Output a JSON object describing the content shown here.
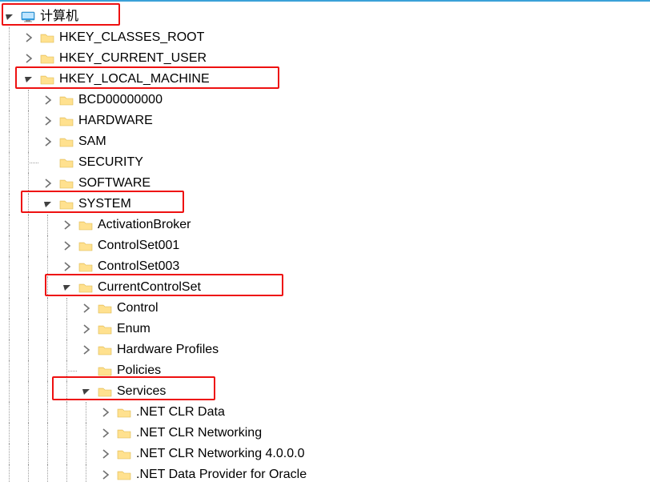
{
  "root": {
    "label": "计算机"
  },
  "hkcr": {
    "label": "HKEY_CLASSES_ROOT"
  },
  "hkcu": {
    "label": "HKEY_CURRENT_USER"
  },
  "hklm": {
    "label": "HKEY_LOCAL_MACHINE"
  },
  "bcd": {
    "label": "BCD00000000"
  },
  "hardware": {
    "label": "HARDWARE"
  },
  "sam": {
    "label": "SAM"
  },
  "security": {
    "label": "SECURITY"
  },
  "software": {
    "label": "SOFTWARE"
  },
  "system": {
    "label": "SYSTEM"
  },
  "activationbroker": {
    "label": "ActivationBroker"
  },
  "cs001": {
    "label": "ControlSet001"
  },
  "cs003": {
    "label": "ControlSet003"
  },
  "ccs": {
    "label": "CurrentControlSet"
  },
  "control": {
    "label": "Control"
  },
  "enum": {
    "label": "Enum"
  },
  "hwprofiles": {
    "label": "Hardware Profiles"
  },
  "policies": {
    "label": "Policies"
  },
  "services": {
    "label": "Services"
  },
  "netclrdata": {
    "label": ".NET CLR Data"
  },
  "netclrnet": {
    "label": ".NET CLR Networking"
  },
  "netclrnet4": {
    "label": ".NET CLR Networking 4.0.0.0"
  },
  "netoracle": {
    "label": ".NET Data Provider for Oracle"
  }
}
